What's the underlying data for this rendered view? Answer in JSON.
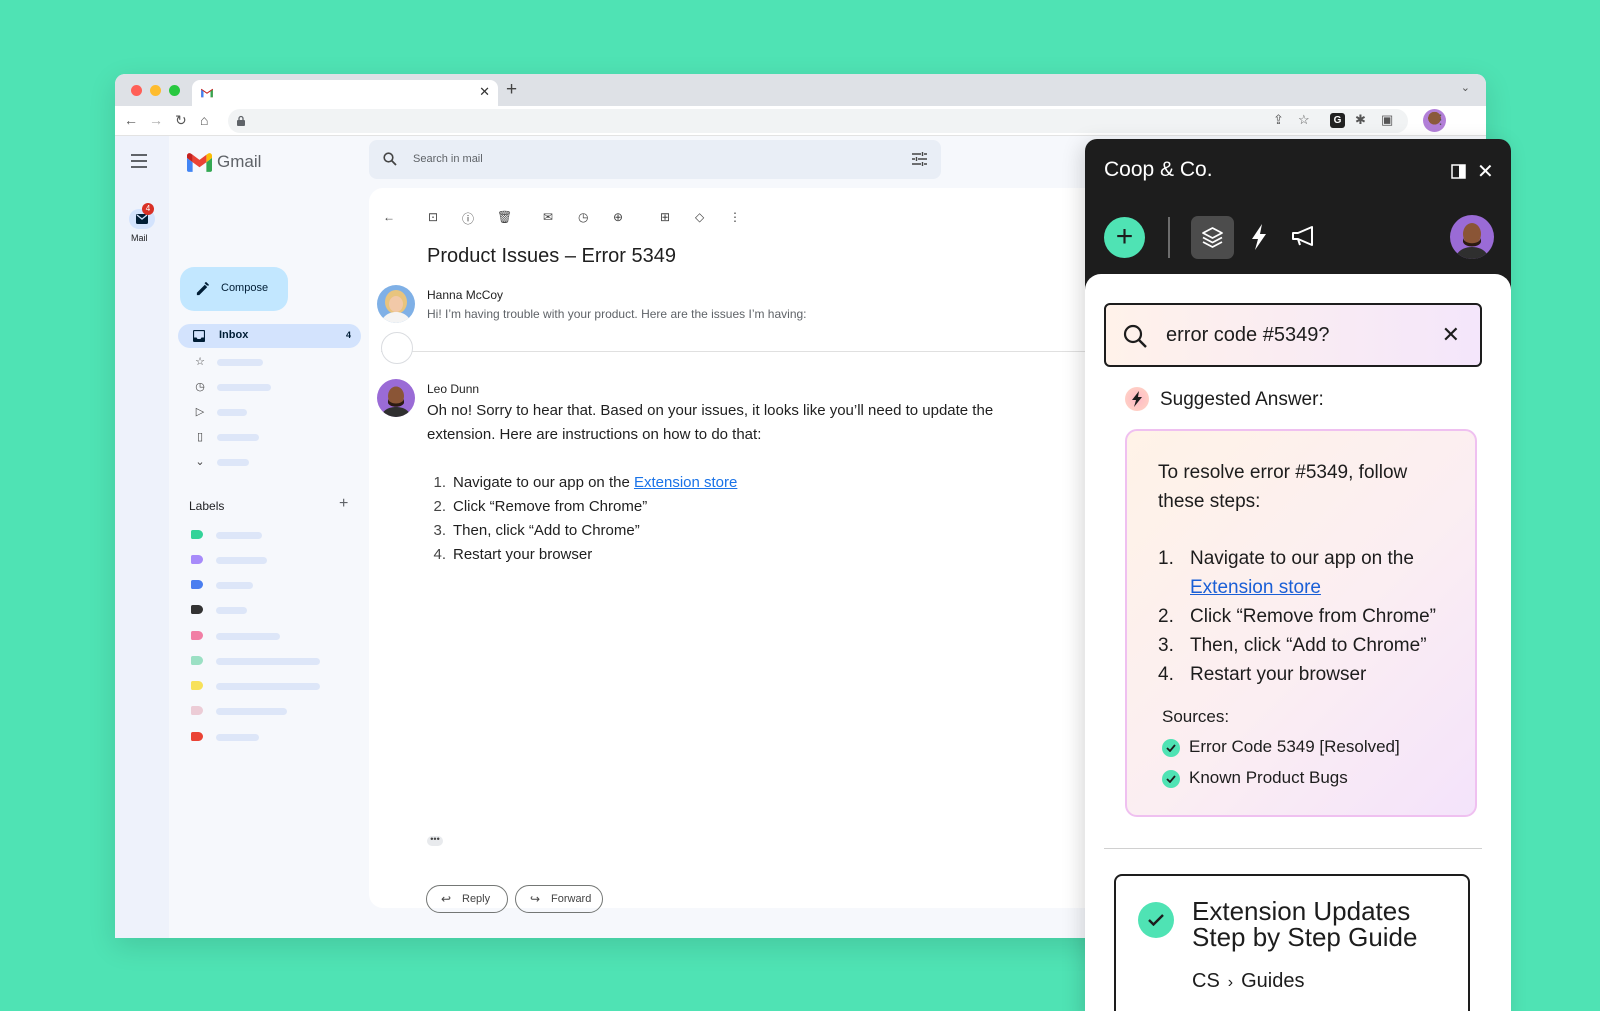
{
  "gmail": {
    "brand": "Gmail",
    "rail_mail_label": "Mail",
    "rail_mail_badge": "4",
    "compose_label": "Compose",
    "inbox_label": "Inbox",
    "inbox_count": "4",
    "labels_title": "Labels",
    "search_placeholder": "Search in mail",
    "label_colors": [
      "#34d399",
      "#a78bfa",
      "#4a7ef0",
      "#333333",
      "#f17fa5",
      "#9be0c4",
      "#f7e15a",
      "#ecccd6",
      "#ea4335"
    ],
    "email": {
      "subject": "Product Issues – Error 5349",
      "first_sender": "Hanna McCoy",
      "first_snippet": "Hi! I’m having trouble with your product. Here are the issues I’m having:",
      "reply_sender": "Leo Dunn",
      "reply_body": "Oh no! Sorry to hear that. Based on your issues, it looks like you’ll need to update the extension. Here are instructions on how to do that:",
      "steps": [
        {
          "num": "1.",
          "text": "Navigate to our app on the ",
          "link": "Extension store"
        },
        {
          "num": "2.",
          "text": "Click “Remove from Chrome”"
        },
        {
          "num": "3.",
          "text": "Then, click “Add to Chrome”"
        },
        {
          "num": "4.",
          "text": "Restart your browser"
        }
      ],
      "more_dots": "•••",
      "reply_button": "Reply",
      "forward_button": "Forward"
    }
  },
  "coop": {
    "title": "Coop & Co.",
    "search_query": "error code #5349?",
    "suggested_title": "Suggested Answer:",
    "answer_intro": "To resolve error #5349, follow these steps:",
    "answer_steps": [
      {
        "num": "1.",
        "text": "Navigate to our app on the ",
        "link": "Extension store"
      },
      {
        "num": "2.",
        "text": "Click “Remove from Chrome”"
      },
      {
        "num": "3.",
        "text": "Then, click “Add to Chrome”"
      },
      {
        "num": "4.",
        "text": "Restart your browser"
      }
    ],
    "sources_label": "Sources:",
    "sources": [
      "Error Code 5349 [Resolved]",
      "Known Product Bugs"
    ],
    "card_title": "Extension Updates Step by Step Guide",
    "card_crumb": [
      "CS",
      "Guides"
    ],
    "accent_color": "#4fe3b4"
  }
}
